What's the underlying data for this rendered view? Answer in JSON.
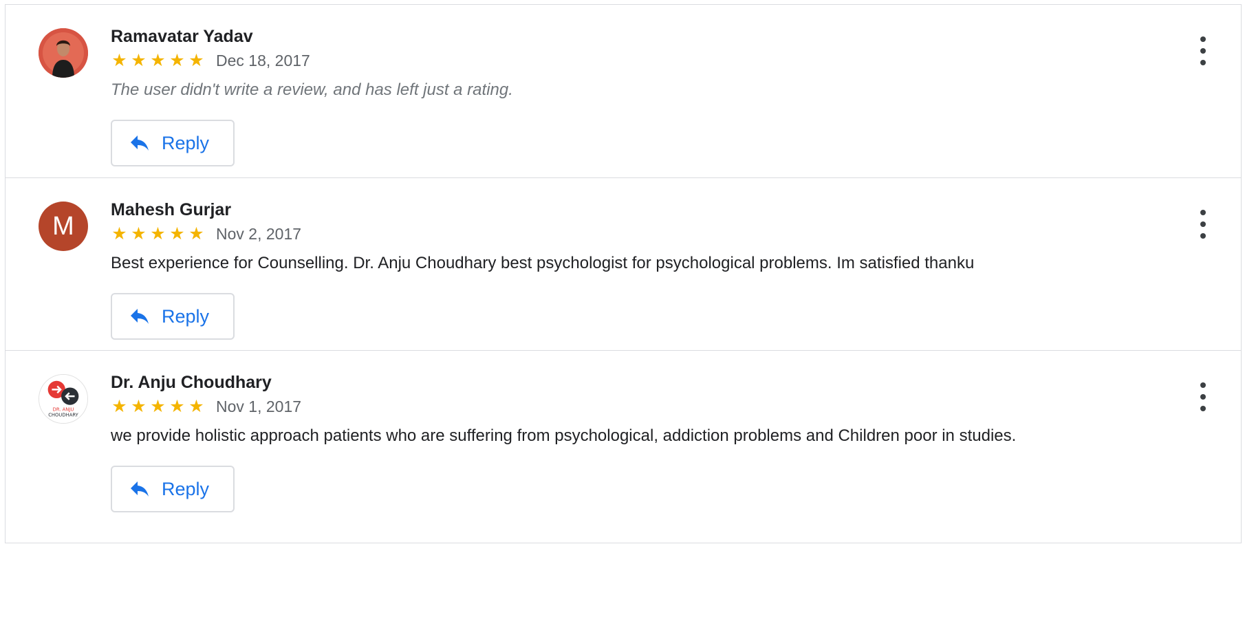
{
  "reviews": [
    {
      "name": "Ramavatar Yadav",
      "rating": 5,
      "date": "Dec 18, 2017",
      "text": "The user didn't write a review, and has left just a rating.",
      "text_is_placeholder": true,
      "avatar": "photo",
      "reply_label": "Reply"
    },
    {
      "name": "Mahesh Gurjar",
      "rating": 5,
      "date": "Nov 2, 2017",
      "text": "Best experience for Counselling. Dr. Anju Choudhary best psychologist for psychological problems. Im satisfied thanku",
      "text_is_placeholder": false,
      "avatar": "letter",
      "avatar_letter": "M",
      "reply_label": "Reply"
    },
    {
      "name": "Dr. Anju Choudhary",
      "rating": 5,
      "date": "Nov 1, 2017",
      "text": "we provide holistic approach patients who are suffering from psychological, addiction problems and Children poor in studies.",
      "text_is_placeholder": false,
      "avatar": "logo",
      "avatar_logo_text": "DR. ANJU CHOUDHARY",
      "reply_label": "Reply"
    }
  ],
  "icons": {
    "star": "star-icon",
    "reply": "reply-icon",
    "menu": "more-vert-icon"
  },
  "colors": {
    "star": "#f4b400",
    "accent": "#1a73e8",
    "avatar_letter_bg": "#b5452a",
    "divider": "#dadce0"
  }
}
